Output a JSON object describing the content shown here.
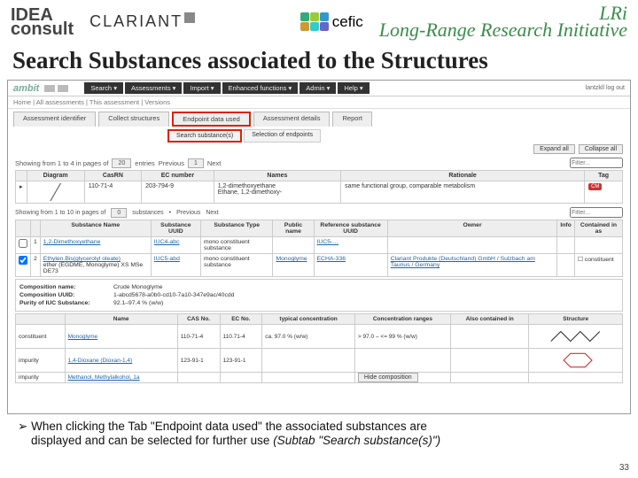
{
  "logos": {
    "idea": "IDEA",
    "idea_sub": "consult",
    "clariant": "CLARIANT",
    "cefic": "cefic",
    "lri": "LRi",
    "lri_sub": "Long-Range Research Initiative"
  },
  "title": "Search Substances associated to the Structures",
  "ambit": {
    "logo": "ambit",
    "nav": [
      "Search ▾",
      "Assessments ▾",
      "Import ▾",
      "Enhanced functions ▾",
      "Admin ▾",
      "Help ▾"
    ],
    "user_right": "lantzkll  log out",
    "breadcrumb": "Home  |  All assessments  |  This assessment  |  Versions"
  },
  "tabs": [
    "Assessment identifier",
    "Collect structures",
    "Endpoint data used",
    "Assessment details",
    "Report"
  ],
  "subtabs": [
    "Search substance(s)",
    "Selection of endpoints"
  ],
  "tools": {
    "expand": "Expand all",
    "collapse": "Collapse all"
  },
  "pager1": {
    "text_a": "Showing from 1 to 4 in pages of",
    "select": "20",
    "text_b": "entries",
    "prev": "Previous",
    "page": "1",
    "next": "Next",
    "filter_ph": "Filter..."
  },
  "table1": {
    "headers": [
      "",
      "Diagram",
      "CasRN",
      "EC number",
      "Names",
      "Rationale",
      "Tag"
    ],
    "row": {
      "cas": "110-71-4",
      "ec": "203-794-9",
      "names": "1,2-dimethoxyethane\nEthane, 1,2-dimethoxy-",
      "rationale": "same functional group, comparable metabolism",
      "tag": "CM"
    }
  },
  "pager2": {
    "text_a": "Showing from 1 to 10 in pages of",
    "select": "0",
    "text_b": "substances",
    "prev": "Previous",
    "next": "Next",
    "filter_ph": "Filter..."
  },
  "table2": {
    "headers": [
      "",
      "",
      "Substance Name",
      "Substance UUID",
      "Substance Type",
      "Public name",
      "Reference substance UUID",
      "Owner",
      "Info",
      "Contained in as"
    ],
    "rows": [
      {
        "name": "1,2-Dimethoxyethane",
        "uuid": "IUC4-abc",
        "type": "mono constituent substance",
        "pub": "",
        "ref": "IUC5-…",
        "owner": "",
        "info": "",
        "contained": ""
      },
      {
        "name": "ether (EGDME, Monoglyme) XS MSe DE73",
        "name_prefix": "Ethylen.Bis(glycerolyl oleate)",
        "uuid": "IUC5-abd",
        "type": "mono constituent substance",
        "pub": "Monoglyme",
        "ref": "ECHA-336",
        "owner": "Clariant Produkte (Deutschland) GmbH / Sulzbach am Taunus / Germany",
        "info": "",
        "contained": "☐ constituent"
      }
    ]
  },
  "detail": {
    "k1": "Composition name:",
    "v1": "Crude Monoglyme",
    "k2": "Composition UUID:",
    "v2": "1-abcd5678-a0b0-cd10-7a10-347e9ac/40cdd",
    "k3": "Purity of IUC Substance:",
    "v3": "92.1–97.4  % (w/w)"
  },
  "table3": {
    "headers": [
      "",
      "Name",
      "CAS No.",
      "EC No.",
      "typical concentration",
      "Concentration ranges",
      "Also contained in",
      "Structure"
    ],
    "rows": [
      {
        "type": "constituent",
        "name": "Monoglyme",
        "cas": "110-71-4",
        "ec": "110.71-4",
        "typ": "ca. 97.0 % (w/w)",
        "range": "> 97.0 – <= 99 % (w/w)"
      },
      {
        "type": "impurity",
        "name": "1,4-Dioxane (Dioxan-1,4)",
        "cas": "123-91-1",
        "ec": "123-91-1",
        "typ": "",
        "range": ""
      },
      {
        "type": "impurity",
        "name": "Methanol, Methylalkohol, 1a",
        "cas": "",
        "ec": "",
        "typ": "",
        "range": "Hide composition"
      }
    ]
  },
  "note": {
    "arrow": "➢",
    "text1": "When clicking the Tab \"Endpoint data used\" the associated substances are",
    "text2": "displayed and can be selected for further use ",
    "text3_italic": "(Subtab \"Search substance(s)\")"
  },
  "page_number": "33"
}
